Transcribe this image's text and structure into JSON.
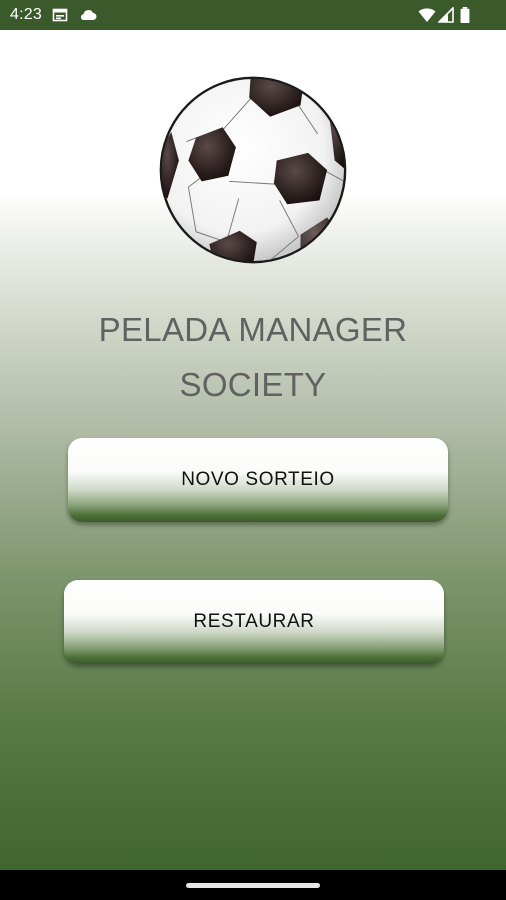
{
  "status_bar": {
    "time": "4:23",
    "icons_left": [
      "calendar-icon",
      "cloud-icon"
    ],
    "icons_right": [
      "wifi-icon",
      "signal-icon",
      "battery-icon"
    ],
    "background_color": "#3a5a2c"
  },
  "app": {
    "logo": "soccer-ball-icon",
    "title_line1": "PELADA MANAGER",
    "title_line2": "SOCIETY"
  },
  "buttons": {
    "new_draw": "NOVO SORTEIO",
    "restore": "RESTAURAR"
  },
  "colors": {
    "title_text": "#616161",
    "gradient_bottom": "#3f6530",
    "button_text": "#111111"
  }
}
